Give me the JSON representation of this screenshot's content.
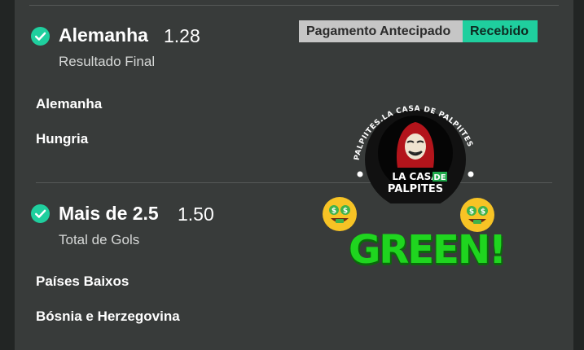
{
  "bets": [
    {
      "selection": "Alemanha",
      "odds": "1.28",
      "market": "Resultado Final",
      "teams": [
        "Alemanha",
        "Hungria"
      ]
    },
    {
      "selection": "Mais de 2.5",
      "odds": "1.50",
      "market": "Total de Gols",
      "teams": [
        "Países Baixos",
        "Bósnia e Herzegovina"
      ]
    }
  ],
  "badges": {
    "early_payout": "Pagamento Antecipado",
    "received": "Recebido"
  },
  "logo": {
    "ring_text": "PALPIITES.LA CASA DE PALPIITES",
    "line1": "LA CASA",
    "line1_tag": "DE",
    "line2": "PALPITES"
  },
  "overlay": {
    "green_text": "GREEN!",
    "emoji": "money-mouth-face-icon"
  },
  "colors": {
    "accent_green": "#1fcf9e",
    "check_green": "#1fcf9e",
    "panel_bg": "#383b3a"
  }
}
